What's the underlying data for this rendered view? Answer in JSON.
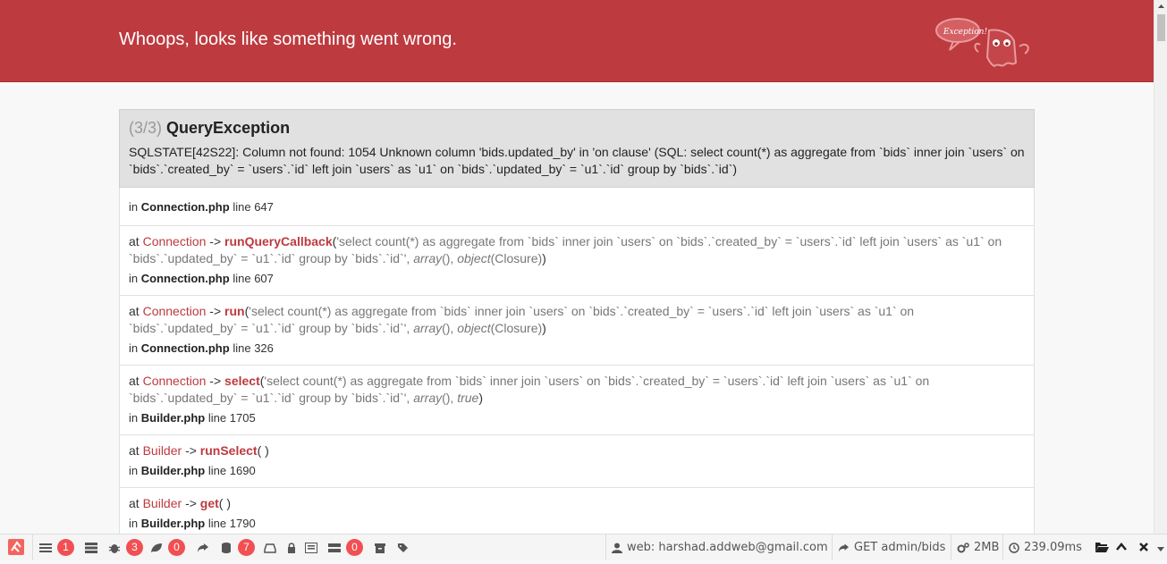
{
  "header": {
    "title": "Whoops, looks like something went wrong.",
    "mascot_text": "Exception!"
  },
  "exception": {
    "count": "(3/3)",
    "name": "QueryException",
    "message": "SQLSTATE[42S22]: Column not found: 1054 Unknown column 'bids.updated_by' in 'on clause' (SQL: select count(*) as aggregate from `bids` inner join `users` on `bids`.`created_by` = `users`.`id` left join `users` as `u1` on `bids`.`updated_by` = `u1`.`id` group by `bids`.`id`)"
  },
  "frames": [
    {
      "in": "in",
      "file": "Connection.php",
      "line_word": "line",
      "line": "647"
    },
    {
      "at": "at",
      "class": "Connection",
      "arrow": "->",
      "method": "runQueryCallback",
      "open": "(",
      "sql": "'select count(*) as aggregate from `bids` inner join `users` on `bids`.`created_by` = `users`.`id` left join `users` as `u1` on `bids`.`updated_by` = `u1`.`id` group by `bids`.`id`'",
      "sep1": ", ",
      "arg2": "array",
      "arg2b": "(), ",
      "arg3": "object",
      "arg3b": "(Closure)",
      "close": ")",
      "in": "in",
      "file": "Connection.php",
      "line_word": "line",
      "line": "607"
    },
    {
      "at": "at",
      "class": "Connection",
      "arrow": "->",
      "method": "run",
      "open": "(",
      "sql": "'select count(*) as aggregate from `bids` inner join `users` on `bids`.`created_by` = `users`.`id` left join `users` as `u1` on `bids`.`updated_by` = `u1`.`id` group by `bids`.`id`'",
      "sep1": ", ",
      "arg2": "array",
      "arg2b": "(), ",
      "arg3": "object",
      "arg3b": "(Closure)",
      "close": ")",
      "in": "in",
      "file": "Connection.php",
      "line_word": "line",
      "line": "326"
    },
    {
      "at": "at",
      "class": "Connection",
      "arrow": "->",
      "method": "select",
      "open": "(",
      "sql": "'select count(*) as aggregate from `bids` inner join `users` on `bids`.`created_by` = `users`.`id` left join `users` as `u1` on `bids`.`updated_by` = `u1`.`id` group by `bids`.`id`'",
      "sep1": ", ",
      "arg2": "array",
      "arg2b": "(), ",
      "arg3": "true",
      "close": ")",
      "in": "in",
      "file": "Builder.php",
      "line_word": "line",
      "line": "1705"
    },
    {
      "at": "at",
      "class": "Builder",
      "arrow": "->",
      "method": "runSelect",
      "call": "( )",
      "in": "in",
      "file": "Builder.php",
      "line_word": "line",
      "line": "1690"
    },
    {
      "at": "at",
      "class": "Builder",
      "arrow": "->",
      "method": "get",
      "call": "( )",
      "in": "in",
      "file": "Builder.php",
      "line_word": "line",
      "line": "1790"
    }
  ],
  "debugbar": {
    "badges": {
      "messages": "1",
      "exceptions": "3",
      "views": "0",
      "queries": "7",
      "mails": "0"
    },
    "user": "web: harshad.addweb@gmail.com",
    "route": "GET admin/bids",
    "memory": "2MB",
    "time": "239.09ms"
  },
  "colors": {
    "header_bg": "#bd3a3f",
    "accent": "#bd3a3f",
    "badge": "#f14f52"
  }
}
